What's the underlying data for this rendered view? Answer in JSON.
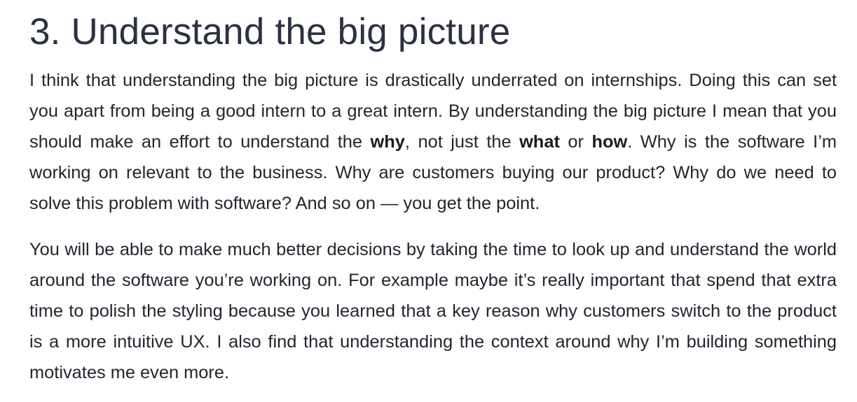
{
  "section": {
    "title": "3. Understand the big picture"
  },
  "paragraph_1": {
    "text_a": "I think that understanding the big picture is drastically underrated on internships. Doing this can set you apart from being a good intern to a great intern. By understanding the big picture I mean that you should make an effort to understand the ",
    "bold_why": "why",
    "text_b": ", not just the ",
    "bold_what": "what",
    "text_c": " or ",
    "bold_how": "how",
    "text_d": ". Why is the software I’m working on relevant to the business. Why are customers buying our product? Why do we need to solve this problem with software? And so on — you get the point."
  },
  "paragraph_2": {
    "text": "You will be able to make much better decisions by taking the time to look up and understand the world around the software you’re working on. For example maybe it’s really important that spend that extra time to polish the styling because you learned that a key reason why customers switch to the product is a more intuitive UX. I also find that understanding the context around why I’m building something motivates me even more."
  }
}
